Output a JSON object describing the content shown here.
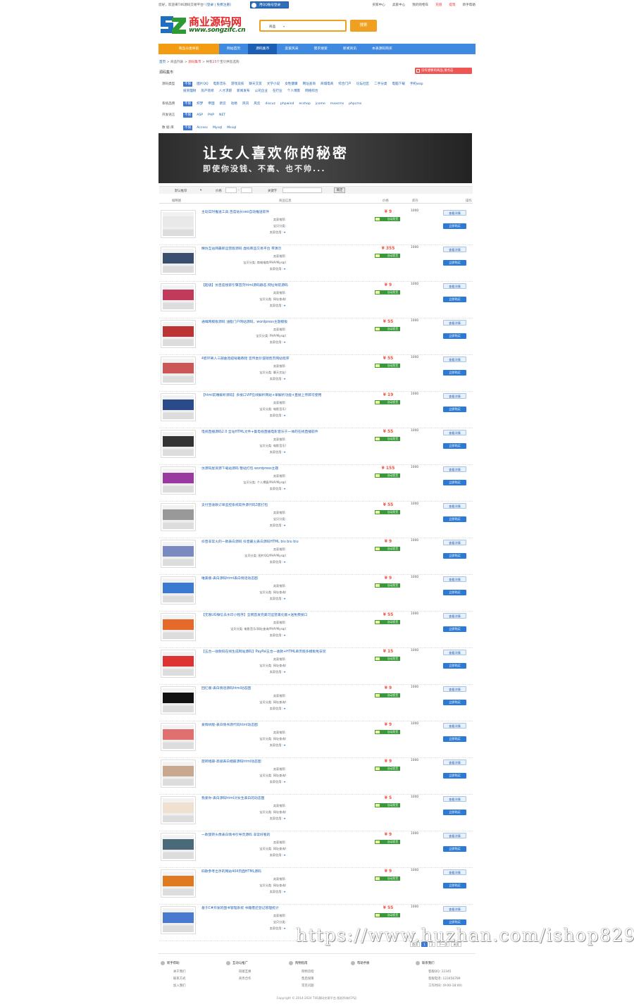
{
  "topbar": {
    "welcome": "您好，欢迎来T46源码交易平台!",
    "login": "[登录",
    "register": "免费注册]",
    "qq_login": "用QQ账号登录",
    "links": [
      "买家中心",
      "卖家中心",
      "我的购物车",
      "充值",
      "提现",
      "新手帮助"
    ]
  },
  "logo": {
    "cn": "商业源码网",
    "url": "www.songzifc.cn"
  },
  "search": {
    "category": "商品",
    "button": "搜索"
  },
  "nav": {
    "items": [
      "商品分类导航",
      "网站首页",
      "源码集市",
      "卖家风采",
      "需求搜索",
      "新闻资讯",
      "本表源码购买"
    ]
  },
  "crumb": {
    "home": "首页",
    "list": "商品列表",
    "market": "源码集市",
    "total_pre": "共有",
    "total_num": "25",
    "total_post": "个宝贝供您选购"
  },
  "section": {
    "title": "源码集市",
    "publish": "没有想要的商品,请点击"
  },
  "filters": [
    {
      "key": "源码类型",
      "all": "不限",
      "values": [
        "图片QQ",
        "电影音乐",
        "游戏竞技",
        "聊天交友",
        "文学小说",
        "女性健康",
        "网址查询",
        "商城电商",
        "综合门户",
        "论坛社区",
        "二手分类",
        "电脑下载",
        "手机wap"
      ]
    },
    {
      "key": "",
      "all": "",
      "values": [
        "投资理财",
        "房产装修",
        "人才求职",
        "新闻发布",
        "公司企业",
        "在行业",
        "个人博客",
        "网络综合"
      ]
    },
    {
      "key": "系统品牌",
      "all": "不限",
      "values": [
        "织梦",
        "帝国",
        "新云",
        "动易",
        "风讯",
        "风云",
        "discuz",
        "phpwind",
        "ecshop",
        "jcome",
        "maxcms",
        "phpcms"
      ]
    },
    {
      "key": "开发语言",
      "all": "不限",
      "values": [
        "ASP",
        "PHP",
        "NET"
      ]
    },
    {
      "key": "数 据 库",
      "all": "不限",
      "values": [
        "Access",
        "Mysql",
        "Mssql"
      ]
    }
  ],
  "banner": {
    "line1": "让女人喜欢你的秘密",
    "line2": "即使你没钱、不高、也不帅..."
  },
  "sort": {
    "default": "默认推荐",
    "price": "价格",
    "keyword": "关键字",
    "confirm": "确定"
  },
  "thead": {
    "thumb": "缩略图",
    "name": "商品信息",
    "price": "价格",
    "stock": "库存",
    "op": "操作"
  },
  "labels": {
    "recommend": "卖家推荐:",
    "category": "宝贝分类:",
    "rating": "卖家信用:",
    "auto": "自动发货",
    "view": "查看详情",
    "buy": "立即购买"
  },
  "products": [
    {
      "title": "主动实时推送工具 百度站长seo自动推送软件",
      "price": "¥ 9",
      "stock": "1000",
      "cat": "",
      "color": "#e9e9e9"
    },
    {
      "title": "精仿互站网最新运营版源码 虚拟商品交易平台 带演示",
      "price": "¥ 355",
      "stock": "1000",
      "cat": "商城电商/PHP/Mysql/",
      "color": "#3a4f70"
    },
    {
      "title": "【超级】仿百度搜索引擎首页html源码静态 网址导航源码",
      "price": "¥ 9",
      "stock": "1000",
      "cat": "网址查询/",
      "color": "#c23a5a"
    },
    {
      "title": "通缉网模板源码 油脂门户网站源码，wordpress主题模板",
      "price": "¥ 55",
      "stock": "1000",
      "cat": "PHP/Mysql/",
      "color": "#b33"
    },
    {
      "title": "4套环男人三部曲泡妞秘籍教程 宣传类价值销售页网站程序",
      "price": "¥ 55",
      "stock": "1000",
      "cat": "聊天交友/",
      "color": "#c55"
    },
    {
      "title": "【html前端解析源码】多接口VIP在线解析网站+单解析功能+直接上传即可使用",
      "price": "¥ 19",
      "stock": "1000",
      "cat": "电影音乐/",
      "color": "#2a4a8a"
    },
    {
      "title": "电视直播源码2.0 全站HTML文件+集电视直播电影音乐于一体的在线直播软件",
      "price": "¥ 55",
      "stock": "1000",
      "cat": "电影音乐/",
      "color": "#333"
    },
    {
      "title": "仿源码屋资源下载站源码 整站打包 wordpress主题",
      "price": "¥ 155",
      "stock": "1000",
      "cat": "个人博客/PHP/Mysql/",
      "color": "#9a3aa0"
    },
    {
      "title": "支付宝收款订单监控系统软件源代码3套打包",
      "price": "¥ 55",
      "stock": "1000",
      "cat": "",
      "color": "#999"
    },
    {
      "title": "抖音非常火的一款表白源码 抖音最火表白源码HTML biu biu biu",
      "price": "¥ 9",
      "stock": "1000",
      "cat": "图片QQ/PHP/Mysql/",
      "color": "#7a8ac0"
    },
    {
      "title": "唯美版-表白源码html表白情话动态图",
      "price": "¥ 9",
      "stock": "1000",
      "cat": "网址查询/",
      "color": "#3a7ad0"
    },
    {
      "title": "【无限UG微信去水印小程序】全网首发完美可运营美化版+送免费接口",
      "price": "¥ 55",
      "stock": "1000",
      "cat": "电影音乐/网址查询/PHP/Mysql/",
      "color": "#e56a2a"
    },
    {
      "title": "【五合一收款码在线生成网站源码】PayPal五合一收款+HTML单页版多模板免安装",
      "price": "¥ 15",
      "stock": "1000",
      "cat": "网址查询/",
      "color": "#d33"
    },
    {
      "title": "回忆版-表白情话源码html动态图",
      "price": "¥ 9",
      "stock": "1000",
      "cat": "网址查询/",
      "color": "#111"
    },
    {
      "title": "爱情树版-表白情书源代码html动态图",
      "price": "¥ 9",
      "stock": "1000",
      "cat": "网址查询/",
      "color": "#e07070"
    },
    {
      "title": "旋转相册-高级表白相册源码html动态图",
      "price": "¥ 9",
      "stock": "1000",
      "cat": "网址查询/",
      "color": "#c9a890"
    },
    {
      "title": "我爱你-表白源码html对女生表白的动态图",
      "price": "¥ 5",
      "stock": "1000",
      "cat": "网址查询/",
      "color": "#f0e0d0"
    },
    {
      "title": "一款旋转头像表白情书引导页源码 非常好看的",
      "price": "¥ 9",
      "stock": "1000",
      "cat": "网址查询/",
      "color": "#4a6a7a"
    },
    {
      "title": "四款参考出手的网站404页面HTML源码",
      "price": "¥ 9",
      "stock": "1000",
      "cat": "网址查询/",
      "color": "#e07a20"
    },
    {
      "title": "基于C#开发的图书管理系统 书籍借还登记管理统计",
      "price": "¥ 55",
      "stock": "1000",
      "cat": "",
      "color": "#4a7ad0"
    }
  ],
  "pager": [
    "首页",
    "1",
    "2",
    "下一页",
    "末页"
  ],
  "watermark": "https://www.huzhan.com/ishop8296",
  "footer": [
    {
      "h": "新手帮助",
      "items": [
        "关于我们",
        "联系方式",
        "加入我们"
      ]
    },
    {
      "h": "互动与推广",
      "items": [
        "链接互换",
        "商务合作"
      ]
    },
    {
      "h": "购物指南",
      "items": [
        "购物流程",
        "售后保障",
        "常见问题"
      ]
    },
    {
      "h": "帮助手册",
      "items": []
    },
    {
      "h": "联系我们",
      "items": [
        "客服QQ: 12345",
        "客服电话: 123456789",
        "工作时间: (9:00-18:00)"
      ]
    }
  ],
  "copyright": "Copyright © 2014-2024 T46源码交易平台 版权所有ICP证:"
}
